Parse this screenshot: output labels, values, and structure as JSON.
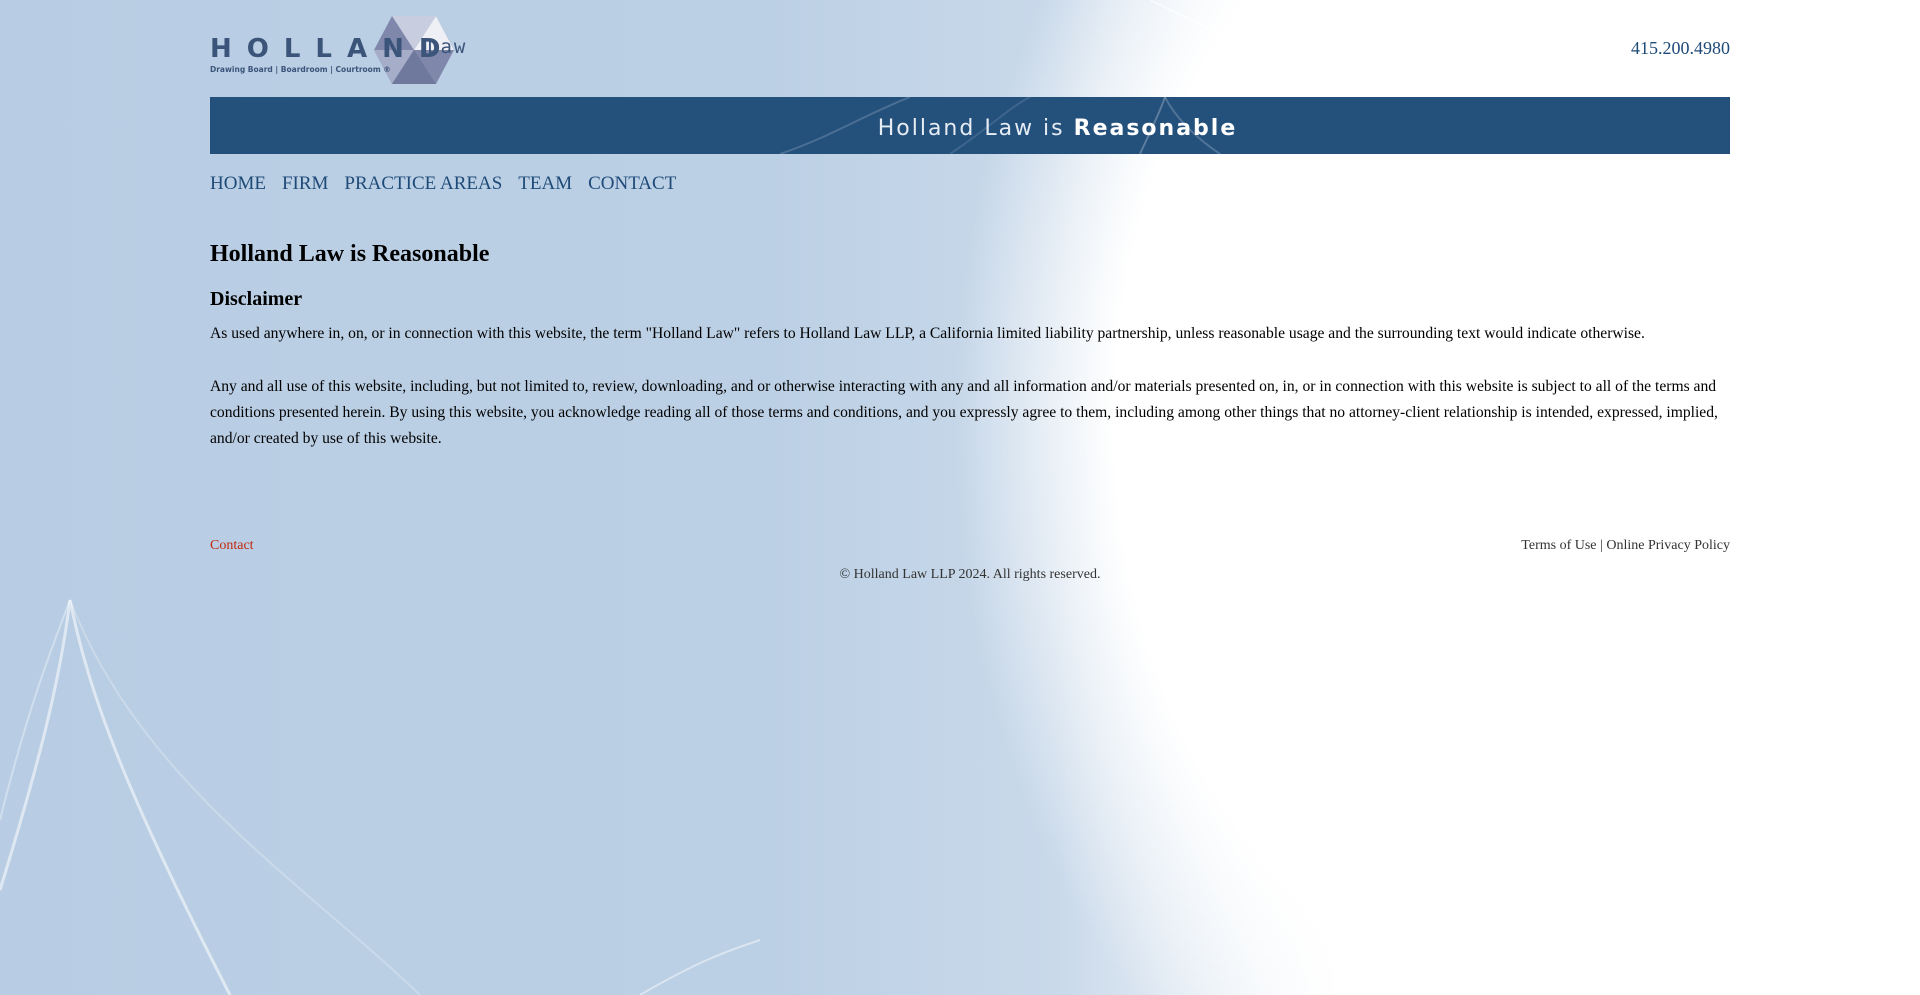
{
  "header": {
    "logo_wordmark": "HOLLAND",
    "logo_suffix": "Law",
    "logo_tagline": "Drawing Board | Boardroom | Courtroom ®",
    "phone": "415.200.4980"
  },
  "banner": {
    "text_regular": "Holland Law is ",
    "text_bold": "Reasonable"
  },
  "nav": {
    "items": [
      {
        "label": "HOME"
      },
      {
        "label": "FIRM"
      },
      {
        "label": "PRACTICE AREAS"
      },
      {
        "label": "TEAM"
      },
      {
        "label": "CONTACT"
      }
    ]
  },
  "main": {
    "title": "Holland Law is Reasonable",
    "subtitle": "Disclaimer",
    "paragraphs": [
      "As used anywhere in, on, or in connection with this website, the term \"Holland Law\" refers to Holland Law LLP, a California limited liability partnership, unless reasonable usage and the surrounding text would indicate otherwise.",
      "Any and all use of this website, including, but not limited to, review, downloading, and or otherwise interacting with any and all information and/or materials presented on, in, or in connection with this website is subject to all of the terms and conditions presented herein. By using this website, you acknowledge reading all of those terms and conditions, and you expressly agree to them, including among other things that no attorney-client relationship is intended, expressed, implied, and/or created by use of this website."
    ]
  },
  "footer": {
    "contact_label": "Contact",
    "terms_label": "Terms of Use",
    "separator": " | ",
    "privacy_label": "Online Privacy Policy",
    "copyright": "© Holland Law LLP 2024. All rights reserved."
  },
  "colors": {
    "brand_blue": "#24507c",
    "link_blue": "#1e4a78",
    "footer_contact": "#c0280f",
    "background_blue": "#b8cde3"
  }
}
